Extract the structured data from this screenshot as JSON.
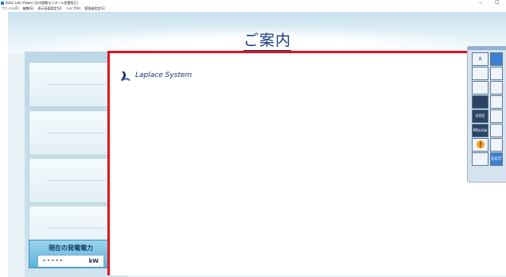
{
  "window": {
    "title": "Solar Link Viewer [社内館動モニタール設置版正]",
    "min_glyph": "–",
    "restore_glyph": "☐"
  },
  "menu": {
    "items": [
      "ファイル(F)",
      "編集(E)",
      "表示画面設定(V)",
      "ヘルプ(H)",
      "管理者設定(S)"
    ]
  },
  "page": {
    "title": "ご案内"
  },
  "power": {
    "label": "現在の発電電力",
    "value": "-----",
    "unit": "kW"
  },
  "logo": {
    "text": "Laplace System"
  },
  "palette": {
    "text_tool": "A",
    "digits_tool": "000",
    "movie_tool": "Movie",
    "exit_tool": "EXIT"
  },
  "colors": {
    "accent_red": "#e0141c",
    "title_blue": "#1a3a7a",
    "panel_blue": "#5cb3dc"
  }
}
